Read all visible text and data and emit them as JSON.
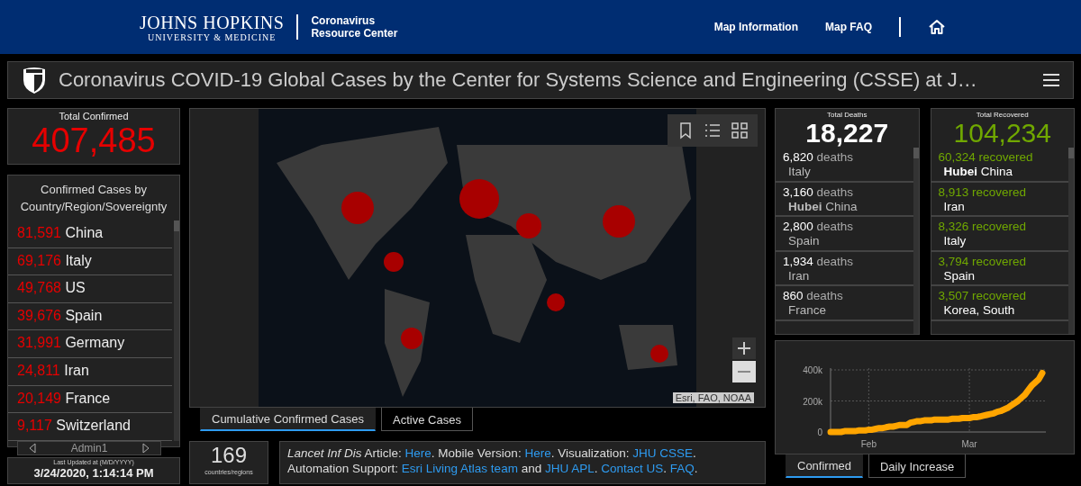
{
  "header": {
    "logo_title": "JOHNS HOPKINS",
    "logo_subtitle": "UNIVERSITY & MEDICINE",
    "site_name": [
      "Coronavirus",
      "Resource Center"
    ],
    "nav": [
      {
        "label": "Map Information"
      },
      {
        "label": "Map FAQ"
      }
    ]
  },
  "dashboard_title": "Coronavirus COVID-19 Global Cases by the Center for Systems Science and Engineering (CSSE) at J…",
  "total_confirmed": {
    "label": "Total Confirmed",
    "value": "407,485"
  },
  "country_list": {
    "title": "Confirmed Cases by Country/Region/Sovereignty",
    "pager": "Admin1",
    "items": [
      {
        "count": "81,591",
        "name": "China"
      },
      {
        "count": "69,176",
        "name": "Italy"
      },
      {
        "count": "49,768",
        "name": "US"
      },
      {
        "count": "39,676",
        "name": "Spain"
      },
      {
        "count": "31,991",
        "name": "Germany"
      },
      {
        "count": "24,811",
        "name": "Iran"
      },
      {
        "count": "20,149",
        "name": "France"
      },
      {
        "count": "9,117",
        "name": "Switzerland"
      }
    ]
  },
  "last_updated": {
    "label": "Last Updated at (M/D/YYYY)",
    "value": "3/24/2020, 1:14:14 PM"
  },
  "map": {
    "attribution": "Esri, FAO, NOAA",
    "tabs": [
      {
        "label": "Cumulative Confirmed Cases",
        "selected": true
      },
      {
        "label": "Active Cases",
        "selected": false
      }
    ]
  },
  "country_count": {
    "value": "169",
    "label": "countries/regions"
  },
  "info": [
    {
      "kind": "text",
      "text": "*Lancet Inf Dis* Article: "
    },
    {
      "kind": "link",
      "text": "Here"
    },
    {
      "kind": "text",
      "text": ". Mobile Version: "
    },
    {
      "kind": "link",
      "text": "Here"
    },
    {
      "kind": "text",
      "text": ". Visualization: "
    },
    {
      "kind": "link",
      "text": "JHU CSSE"
    },
    {
      "kind": "text",
      "text": ". Automation Support: "
    },
    {
      "kind": "link",
      "text": "Esri Living Atlas team"
    },
    {
      "kind": "text",
      "text": " and "
    },
    {
      "kind": "link",
      "text": "JHU APL"
    },
    {
      "kind": "text",
      "text": ". "
    },
    {
      "kind": "link",
      "text": "Contact US"
    },
    {
      "kind": "text",
      "text": ". "
    },
    {
      "kind": "link",
      "text": "FAQ"
    },
    {
      "kind": "text",
      "text": "."
    }
  ],
  "deaths": {
    "label": "Total Deaths",
    "value": "18,227",
    "items": [
      {
        "count": "6,820",
        "unit": "deaths",
        "place": "Italy"
      },
      {
        "count": "3,160",
        "unit": "deaths",
        "place": "**Hubei** China"
      },
      {
        "count": "2,800",
        "unit": "deaths",
        "place": "Spain"
      },
      {
        "count": "1,934",
        "unit": "deaths",
        "place": "Iran"
      },
      {
        "count": "860",
        "unit": "deaths",
        "place": "France"
      }
    ]
  },
  "recovered": {
    "label": "Total Recovered",
    "value": "104,234",
    "items": [
      {
        "count": "60,324",
        "unit": "recovered",
        "place": "**Hubei** China"
      },
      {
        "count": "8,913",
        "unit": "recovered",
        "place": "Iran"
      },
      {
        "count": "8,326",
        "unit": "recovered",
        "place": "Italy"
      },
      {
        "count": "3,794",
        "unit": "recovered",
        "place": "Spain"
      },
      {
        "count": "3,507",
        "unit": "recovered",
        "place": "Korea, South"
      }
    ]
  },
  "trend": {
    "chart_data": {
      "type": "line",
      "categories": [
        null,
        null,
        null,
        null,
        null,
        null,
        null,
        null,
        null,
        null,
        null,
        "Feb",
        null,
        null,
        null,
        null,
        null,
        null,
        null,
        null,
        null,
        null,
        null,
        null,
        null,
        null,
        null,
        null,
        null,
        null,
        null,
        null,
        null,
        null,
        null,
        null,
        null,
        null,
        null,
        null,
        "Mar",
        null,
        null,
        null,
        null,
        null,
        null,
        null,
        null,
        null,
        null,
        null,
        null,
        null,
        null,
        null,
        null,
        null,
        null,
        null,
        null,
        null
      ],
      "ylim": [
        0,
        400000
      ],
      "grid": true,
      "series": [
        {
          "color": "#ffa500",
          "values": [
            0,
            0,
            0,
            0,
            5000,
            5000,
            5000,
            5000,
            10000,
            10000,
            10000,
            15000,
            15000,
            20000,
            25000,
            25000,
            30000,
            35000,
            35000,
            40000,
            45000,
            45000,
            45000,
            60000,
            65000,
            70000,
            70000,
            75000,
            75000,
            75000,
            80000,
            80000,
            80000,
            80000,
            80000,
            85000,
            85000,
            85000,
            90000,
            90000,
            90000,
            95000,
            95000,
            100000,
            105000,
            110000,
            115000,
            120000,
            130000,
            135000,
            145000,
            155000,
            170000,
            185000,
            200000,
            220000,
            240000,
            270000,
            300000,
            320000,
            340000,
            380000
          ]
        }
      ],
      "yticks": [
        {
          "value": 0,
          "label": "0"
        },
        {
          "value": 200000,
          "label": "200k"
        },
        {
          "value": 400000,
          "label": "400k"
        }
      ]
    },
    "tabs": [
      {
        "label": "Confirmed",
        "selected": true
      },
      {
        "label": "Daily Increase",
        "selected": false
      }
    ]
  }
}
